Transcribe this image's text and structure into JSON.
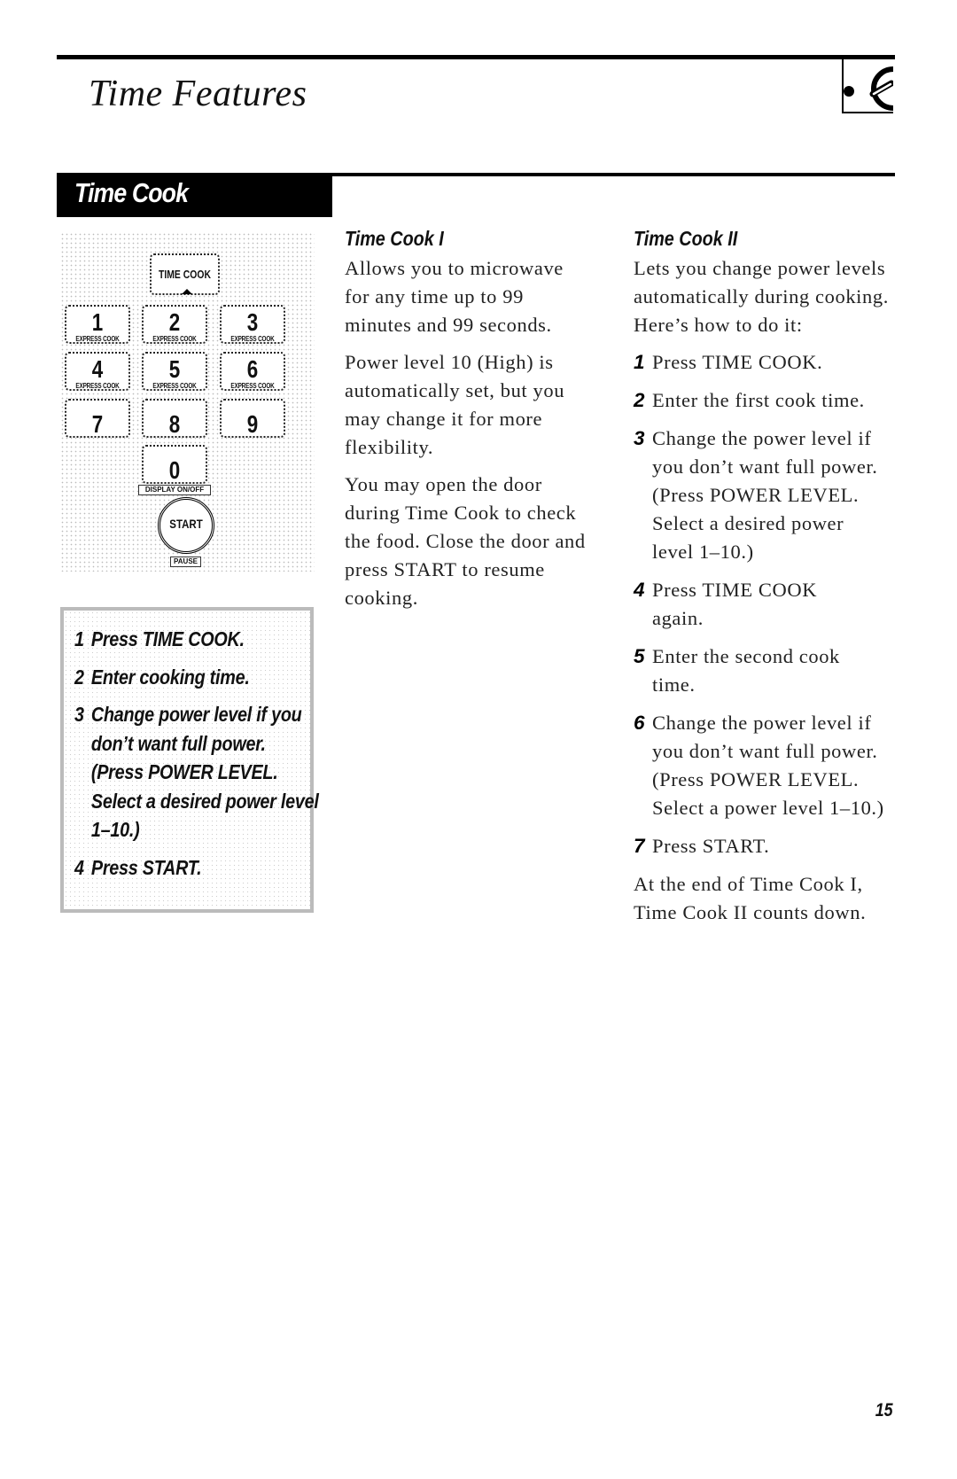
{
  "header": {
    "title": "Time Features",
    "section_icon": "microwave-timer-icon"
  },
  "section": {
    "title": "Time Cook"
  },
  "keypad": {
    "time_cook": "TIME COOK",
    "keys": [
      {
        "num": "1",
        "sub": "EXPRESS COOK"
      },
      {
        "num": "2",
        "sub": "EXPRESS COOK"
      },
      {
        "num": "3",
        "sub": "EXPRESS COOK"
      },
      {
        "num": "4",
        "sub": "EXPRESS COOK"
      },
      {
        "num": "5",
        "sub": "EXPRESS COOK"
      },
      {
        "num": "6",
        "sub": "EXPRESS COOK"
      },
      {
        "num": "7",
        "sub": ""
      },
      {
        "num": "8",
        "sub": ""
      },
      {
        "num": "9",
        "sub": ""
      },
      {
        "num": "0",
        "sub": ""
      }
    ],
    "display_label": "DISPLAY ON/OFF",
    "start": "START",
    "pause_label": "PAUSE"
  },
  "quick_steps": [
    {
      "n": "1",
      "text": "Press TIME COOK."
    },
    {
      "n": "2",
      "text": "Enter cooking time."
    },
    {
      "n": "3",
      "text": "Change power level if you don’t want full power. (Press POWER LEVEL. Select a desired power level 1–10.)"
    },
    {
      "n": "4",
      "text": "Press START."
    }
  ],
  "time_cook_1": {
    "heading": "Time Cook I",
    "paragraphs": [
      "Allows you to microwave for any time up to 99 minutes and 99 seconds.",
      "Power level 10 (High) is automatically set, but you may change it for more flexibility.",
      "You may open the door during Time Cook to check the food. Close the door and press START to resume cooking."
    ]
  },
  "time_cook_2": {
    "heading": "Time Cook II",
    "intro": "Lets you change power levels automatically during cooking. Here’s how to do it:",
    "steps": [
      {
        "n": "1",
        "text": "Press TIME COOK."
      },
      {
        "n": "2",
        "text": "Enter the first cook time."
      },
      {
        "n": "3",
        "text": "Change the power level if you don’t want full power. (Press POWER LEVEL. Select a desired power level 1–10.)"
      },
      {
        "n": "4",
        "text": "Press TIME COOK again."
      },
      {
        "n": "5",
        "text": "Enter the second cook time."
      },
      {
        "n": "6",
        "text": "Change the power level if you don’t want full power. (Press POWER LEVEL. Select a power level 1–10.)"
      },
      {
        "n": "7",
        "text": "Press START."
      }
    ],
    "outro": "At the end of Time Cook I, Time Cook II counts down."
  },
  "footer": {
    "page_number": "15"
  }
}
